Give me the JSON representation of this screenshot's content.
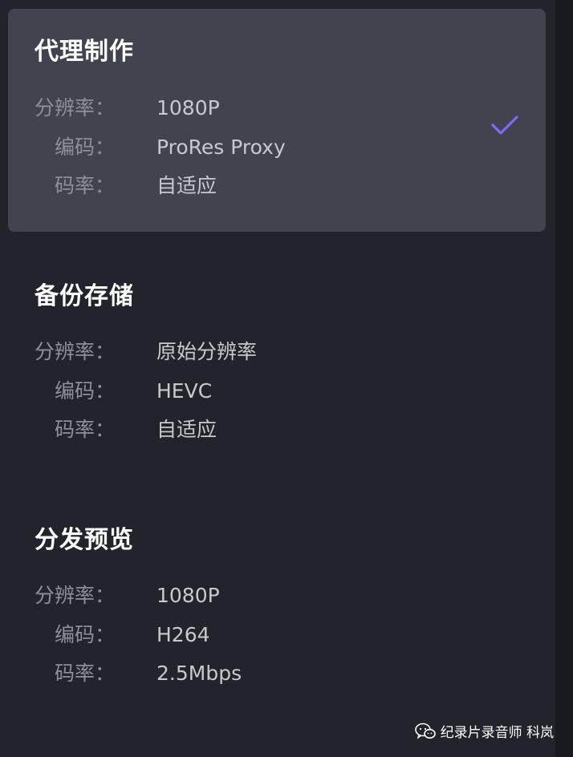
{
  "sections": [
    {
      "title": "代理制作",
      "selected": true,
      "rows": [
        {
          "label": "分辨率：",
          "value": "1080P"
        },
        {
          "label": "编码：",
          "value": "ProRes Proxy"
        },
        {
          "label": "码率：",
          "value": "自适应"
        }
      ],
      "check_icon": "checkmark-icon"
    },
    {
      "title": "备份存储",
      "selected": false,
      "rows": [
        {
          "label": "分辨率：",
          "value": "原始分辨率"
        },
        {
          "label": "编码：",
          "value": "HEVC"
        },
        {
          "label": "码率：",
          "value": "自适应"
        }
      ]
    },
    {
      "title": "分发预览",
      "selected": false,
      "rows": [
        {
          "label": "分辨率：",
          "value": "1080P"
        },
        {
          "label": "编码：",
          "value": "H264"
        },
        {
          "label": "码率：",
          "value": "2.5Mbps"
        }
      ]
    }
  ],
  "watermark": {
    "icon": "wechat-icon",
    "text": "纪录片录音师 科岚"
  },
  "colors": {
    "background": "#22232b",
    "selected_card": "#41434f",
    "accent_check": "#7b6cf6",
    "label": "#8d8f99",
    "value": "#c8c9cf",
    "title": "#ffffff"
  }
}
